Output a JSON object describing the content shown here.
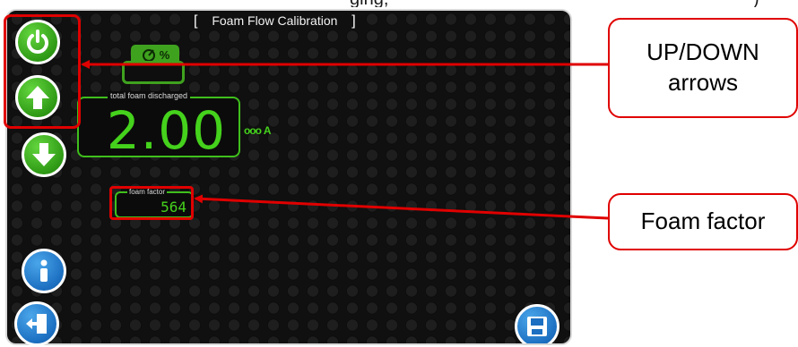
{
  "caption_partial": "ging,",
  "caption_partial_right": ")",
  "screen": {
    "title": "Foam Flow Calibration",
    "title_bracket_left": "[",
    "title_bracket_right": "]"
  },
  "buttons": [
    {
      "name": "power-button",
      "icon": "power-icon",
      "color": "#2f9a15"
    },
    {
      "name": "up-arrow-button",
      "icon": "arrow-up-icon",
      "color": "#2f9a15"
    },
    {
      "name": "down-arrow-button",
      "icon": "arrow-down-icon",
      "color": "#2f9a15"
    },
    {
      "name": "info-button",
      "icon": "info-icon",
      "color": "#1c6fc1"
    },
    {
      "name": "exit-button",
      "icon": "exit-door-icon",
      "color": "#1c6fc1"
    },
    {
      "name": "save-button",
      "icon": "floppy-disk-icon",
      "color": "#1c6fc1"
    }
  ],
  "foam_percent": {
    "icon": "foam-gauge-icon",
    "symbol": "%",
    "value": ""
  },
  "total_foam": {
    "legend": "total foam discharged",
    "value": "2.00",
    "unit_icon": "foam-units-icon",
    "unit": "A"
  },
  "foam_factor": {
    "legend": "foam factor",
    "value": "564"
  },
  "callouts": {
    "updown": "UP/DOWN arrows",
    "foam_factor": "Foam factor"
  },
  "colors": {
    "highlight": "#e00000",
    "display_green": "#45d21c",
    "button_green": "#2f9a15",
    "button_blue": "#1c6fc1"
  }
}
